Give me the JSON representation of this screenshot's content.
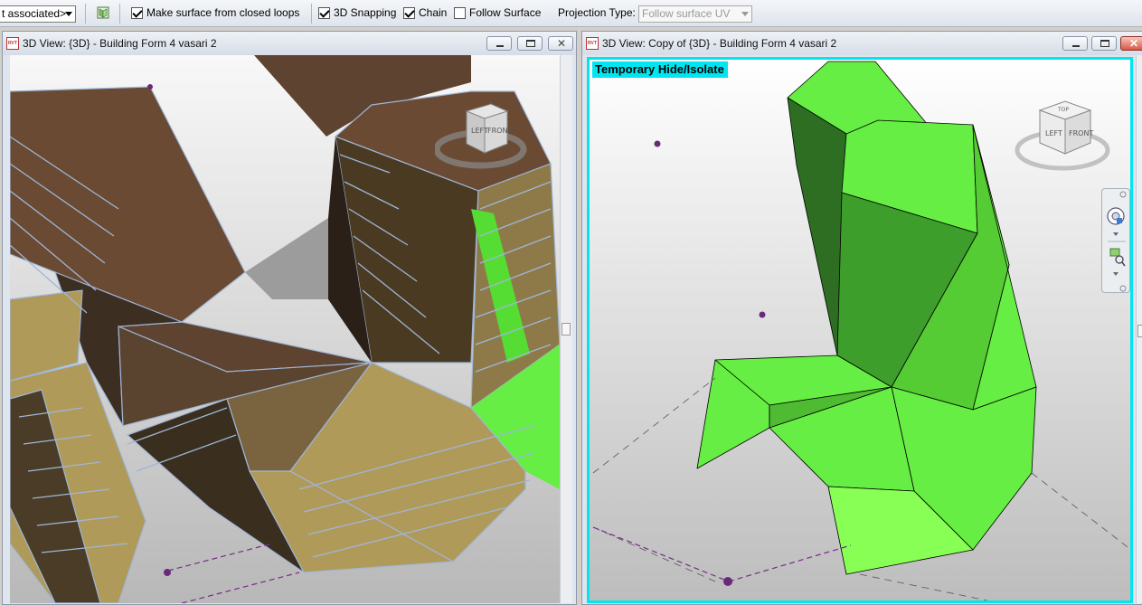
{
  "options_bar": {
    "association_dropdown_value": "t associated>",
    "make_surface_label": "Make surface from closed loops",
    "make_surface_checked": true,
    "snapping_label": "3D Snapping",
    "snapping_checked": true,
    "chain_label": "Chain",
    "chain_checked": true,
    "follow_surface_label": "Follow Surface",
    "follow_surface_checked": false,
    "projection_type_label": "Projection Type:",
    "projection_type_value": "Follow surface UV"
  },
  "left_view": {
    "title": "3D View: {3D} - Building Form 4 vasari 2",
    "file_badge": "RVT",
    "viewcube": {
      "left_face": "LEFT",
      "front_face": "FRONT"
    }
  },
  "right_view": {
    "title": "3D View: Copy of {3D} - Building Form 4 vasari 2",
    "file_badge": "RVT",
    "hide_isolate_label": "Temporary Hide/Isolate",
    "hide_isolate_color": "#00e5f0",
    "viewcube": {
      "top_face": "TOP",
      "left_face": "LEFT",
      "front_face": "FRONT"
    }
  },
  "colors": {
    "brown_form": "#6a4a32",
    "tan_form": "#b09a5a",
    "green_form": "#66ee44",
    "wire": "#9fb6d8"
  }
}
